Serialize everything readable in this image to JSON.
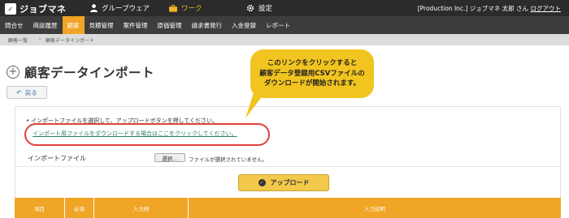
{
  "topbar": {
    "logo_mark": "✓",
    "logo": "ジョブマネ",
    "groupware": "グループウェア",
    "work": "ワーク",
    "settings": "設定",
    "user": "[Production Inc.] ジョブマネ 太郎 さん",
    "logout": "ログアウト"
  },
  "subnav": {
    "items": [
      "問合せ",
      "商談履歴",
      "顧客",
      "見積管理",
      "案件管理",
      "原価管理",
      "請求書発行",
      "入金登録",
      "レポート"
    ]
  },
  "breadcrumb": {
    "items": [
      "顧客一覧",
      "顧客データインポート"
    ]
  },
  "page": {
    "title": "顧客データインポート",
    "back": "戻る"
  },
  "form": {
    "instruction": "インポートファイルを選択して、アップロードボタンを押してください。",
    "download_link": "インポート用ファイルをダウンロードする場合はここをクリックしてください。",
    "file_label": "インポートファイル",
    "file_button": "選択...",
    "file_status": "ファイルが選択されていません。",
    "upload": "アップロード"
  },
  "table": {
    "headers": [
      "項目",
      "必須",
      "入力例",
      "入力説明"
    ]
  },
  "callout": {
    "lines": [
      "このリンクをクリックすると",
      "顧客データ登録用CSVファイルの",
      "ダウンロードが開始されます。"
    ]
  },
  "colors": {
    "accent": "#f0a526",
    "callout": "#f2c41f",
    "highlight": "#e0413c",
    "link": "#2f7d6b"
  }
}
